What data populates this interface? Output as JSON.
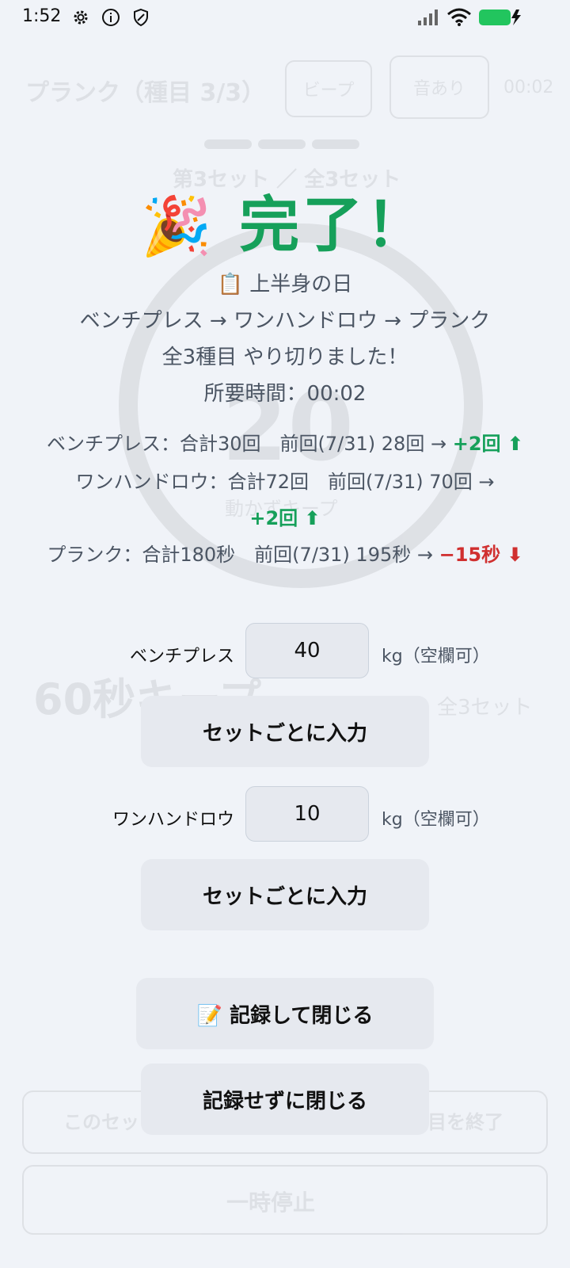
{
  "status_bar": {
    "time": "1:52"
  },
  "background": {
    "title": "プランク（種目 3/3）",
    "beep_button": "ビープ",
    "sound_button": "音あり",
    "timer": "00:02",
    "set_label": "第3セット ／ 全3セット",
    "count": "20",
    "count_label": "動かずキープ",
    "keep_label": "60秒キープ",
    "total_sets": "全3セット",
    "end_set_button": "このセット",
    "end_exercise_button": "目を終了",
    "pause_button": "一時停止"
  },
  "modal": {
    "title": "完了！",
    "title_emoji": "🎉",
    "day_label": "📋 上半身の日",
    "sequence": "ベンチプレス → ワンハンドロウ → プランク",
    "completed_msg": "全3種目 やり切りました！",
    "duration": "所要時間：00:02",
    "stats": [
      {
        "text": "ベンチプレス：合計30回　前回(7/31) 28回 →",
        "delta": "+2回 ⬆"
      },
      {
        "text": "ワンハンドロウ：合計72回　前回(7/31) 70回 →",
        "delta": "+2回 ⬆"
      },
      {
        "text": "プランク：合計180秒　前回(7/31) 195秒 →",
        "delta": "−15秒 ⬇"
      }
    ],
    "weights": [
      {
        "label": "ベンチプレス",
        "value": "40",
        "unit": "kg（空欄可）",
        "per_set_button": "セットごとに入力"
      },
      {
        "label": "ワンハンドロウ",
        "value": "10",
        "unit": "kg（空欄可）",
        "per_set_button": "セットごとに入力"
      }
    ],
    "save_close_button": "📝 記録して閉じる",
    "close_no_save_button": "記録せずに閉じる"
  },
  "colors": {
    "accent_green": "#16a05a",
    "down_red": "#d02f2f",
    "background": "#f0f3f8",
    "button_bg": "#e6e9ef"
  }
}
